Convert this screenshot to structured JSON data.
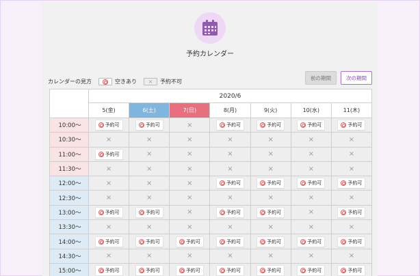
{
  "title": "予約カレンダー",
  "legend": {
    "heading": "カレンダーの見方",
    "available": "空きあり",
    "unavailable": "予約不可"
  },
  "nav": {
    "prev": "前の期間",
    "next": "次の期間"
  },
  "month": "2020/6",
  "days": [
    {
      "label": "5(金)",
      "kind": "weekday"
    },
    {
      "label": "6(土)",
      "kind": "sat"
    },
    {
      "label": "7(日)",
      "kind": "sun"
    },
    {
      "label": "8(月)",
      "kind": "weekday"
    },
    {
      "label": "9(火)",
      "kind": "weekday"
    },
    {
      "label": "10(水)",
      "kind": "weekday"
    },
    {
      "label": "11(木)",
      "kind": "weekday"
    }
  ],
  "slot_label": "予約可",
  "unavailable_mark": "×",
  "rows": [
    {
      "time": "10:00〜",
      "band": "morning",
      "slots": [
        1,
        1,
        0,
        1,
        1,
        1,
        1
      ]
    },
    {
      "time": "10:30〜",
      "band": "morning",
      "slots": [
        0,
        0,
        0,
        0,
        0,
        0,
        0
      ]
    },
    {
      "time": "11:00〜",
      "band": "morning",
      "slots": [
        1,
        0,
        0,
        0,
        0,
        0,
        0
      ]
    },
    {
      "time": "11:30〜",
      "band": "morning",
      "slots": [
        0,
        0,
        0,
        0,
        0,
        0,
        0
      ]
    },
    {
      "time": "12:00〜",
      "band": "noon",
      "slots": [
        0,
        0,
        0,
        1,
        1,
        1,
        1
      ]
    },
    {
      "time": "12:30〜",
      "band": "noon",
      "slots": [
        0,
        0,
        0,
        0,
        0,
        0,
        0
      ]
    },
    {
      "time": "13:00〜",
      "band": "noon",
      "slots": [
        1,
        1,
        0,
        1,
        1,
        0,
        1
      ]
    },
    {
      "time": "13:30〜",
      "band": "noon",
      "slots": [
        0,
        0,
        0,
        0,
        0,
        0,
        0
      ]
    },
    {
      "time": "14:00〜",
      "band": "noon",
      "slots": [
        1,
        1,
        1,
        1,
        1,
        1,
        1
      ]
    },
    {
      "time": "14:30〜",
      "band": "noon",
      "slots": [
        0,
        0,
        0,
        0,
        0,
        0,
        0
      ]
    },
    {
      "time": "15:00〜",
      "band": "noon",
      "slots": [
        1,
        1,
        1,
        1,
        1,
        1,
        1
      ]
    }
  ]
}
